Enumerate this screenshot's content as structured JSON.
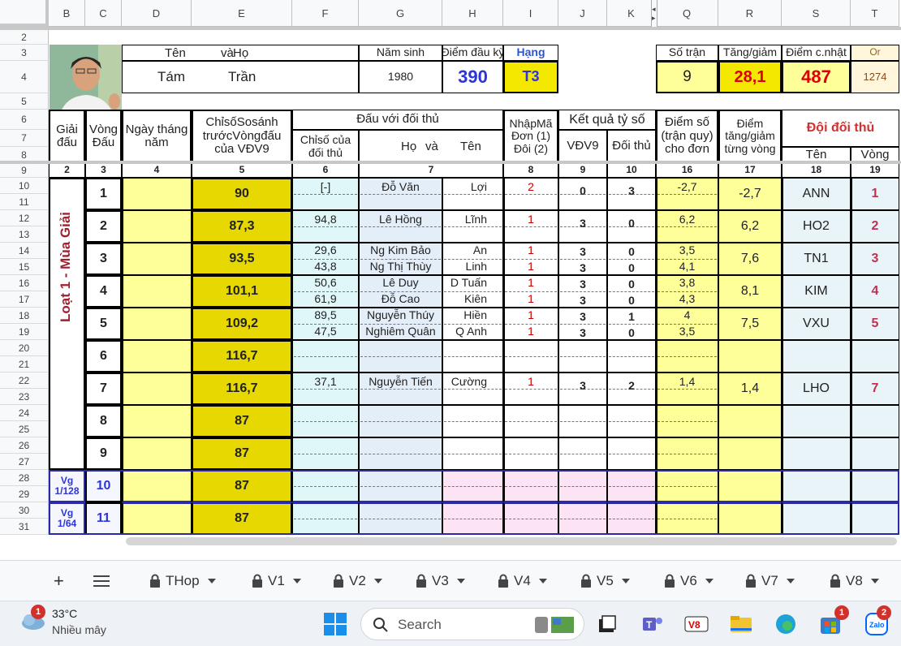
{
  "columns": [
    "B",
    "C",
    "D",
    "E",
    "F",
    "G",
    "H",
    "I",
    "J",
    "K",
    "Q",
    "R",
    "S",
    "T"
  ],
  "rows": [
    "2",
    "3",
    "4",
    "5",
    "6",
    "7",
    "8",
    "9",
    "10",
    "11",
    "12",
    "13",
    "14",
    "15",
    "16",
    "17",
    "18",
    "19",
    "20",
    "21",
    "22",
    "23",
    "24",
    "25",
    "26",
    "27",
    "28",
    "29",
    "30",
    "31"
  ],
  "header": {
    "ten_va_ho_label": [
      "Tên",
      "và",
      "Họ"
    ],
    "nam_sinh_label": "Năm sinh",
    "diem_dau_ky_label": "Điểm đầu kỳ",
    "hang_label": "Hạng",
    "ten": "Tám",
    "ho": "Trần",
    "nam_sinh": "1980",
    "diem_dau_ky": "390",
    "hang": "T3",
    "so_tran_label": "Số trận",
    "tang_giam_label": "Tăng/giảm",
    "diem_cnhat_label": "Điểm c.nhật",
    "or_label": "Or",
    "so_tran": "9",
    "tang_giam": "28,1",
    "diem_cnhat": "487",
    "or_value": "1274"
  },
  "table_head": {
    "giai_dau": "Giải đấu",
    "vong_dau": "Vòng Đấu",
    "ngay": "Ngày tháng năm",
    "chiso": "ChỉsốSosánh trướcVòngđấu của VĐV9",
    "dau_voi": "Đấu với đối thủ",
    "chiso_doithu": "Chỉsố của đối thủ",
    "ho": "Họ",
    "va": "và",
    "ten": "Tên",
    "nhapma": "NhậpMã Đơn (1) Đôi (2)",
    "ketqua": "Kết quả tỷ số",
    "vdv9": "VĐV9",
    "doithu": "Đối thủ",
    "diemso": "Điểm số (trận quy) cho đơn",
    "diem_tg": "Điểm tăng/giảm từng vòng",
    "doi_doithu": "Đội đối thủ",
    "ten2": "Tên",
    "vong": "Vòng",
    "nums": [
      "2",
      "3",
      "4",
      "5",
      "6",
      "7",
      "8",
      "9",
      "10",
      "16",
      "17",
      "18",
      "19"
    ]
  },
  "season_label": "Loạt 1 - Mùa Giải",
  "rounds": [
    {
      "vong": "1",
      "chiso": "90",
      "lines": [
        {
          "cs": "[-]",
          "ho": "Đỗ Văn",
          "ten": "Lợi",
          "ma": "2",
          "v": "0",
          "d": "3",
          "pts": "-2,7"
        }
      ],
      "tg": "-2,7",
      "team": "ANN",
      "tv": "1"
    },
    {
      "vong": "2",
      "chiso": "87,3",
      "lines": [
        {
          "cs": "94,8",
          "ho": "Lê Hồng",
          "ten": "Lĩnh",
          "ma": "1",
          "v": "3",
          "d": "0",
          "pts": "6,2"
        }
      ],
      "tg": "6,2",
      "team": "HO2",
      "tv": "2"
    },
    {
      "vong": "3",
      "chiso": "93,5",
      "lines": [
        {
          "cs": "29,6",
          "ho": "Ng Kim Bảo",
          "ten": "An",
          "ma": "1",
          "v": "3",
          "d": "0",
          "pts": "3,5"
        },
        {
          "cs": "43,8",
          "ho": "Ng Thị Thùy",
          "ten": "Linh",
          "ma": "1",
          "v": "3",
          "d": "0",
          "pts": "4,1"
        }
      ],
      "tg": "7,6",
      "team": "TN1",
      "tv": "3"
    },
    {
      "vong": "4",
      "chiso": "101,1",
      "lines": [
        {
          "cs": "50,6",
          "ho": "Lê Duy",
          "ten": "D Tuấn",
          "ma": "1",
          "v": "3",
          "d": "0",
          "pts": "3,8"
        },
        {
          "cs": "61,9",
          "ho": "Đỗ Cao",
          "ten": "Kiên",
          "ma": "1",
          "v": "3",
          "d": "0",
          "pts": "4,3"
        }
      ],
      "tg": "8,1",
      "team": "KIM",
      "tv": "4"
    },
    {
      "vong": "5",
      "chiso": "109,2",
      "lines": [
        {
          "cs": "89,5",
          "ho": "Nguyễn Thúy",
          "ten": "Hiền",
          "ma": "1",
          "v": "3",
          "d": "1",
          "pts": "4"
        },
        {
          "cs": "47,5",
          "ho": "Nghiêm Quân",
          "ten": "Q Anh",
          "ma": "1",
          "v": "3",
          "d": "0",
          "pts": "3,5"
        }
      ],
      "tg": "7,5",
      "team": "VXU",
      "tv": "5"
    },
    {
      "vong": "6",
      "chiso": "116,7",
      "lines": [],
      "tg": "",
      "team": "",
      "tv": ""
    },
    {
      "vong": "7",
      "chiso": "116,7",
      "lines": [
        {
          "cs": "37,1",
          "ho": "Nguyễn Tiến",
          "ten": "Cường",
          "ma": "1",
          "v": "3",
          "d": "2",
          "pts": "1,4"
        }
      ],
      "tg": "1,4",
      "team": "LHO",
      "tv": "7"
    },
    {
      "vong": "8",
      "chiso": "87",
      "lines": [],
      "tg": "",
      "team": "",
      "tv": ""
    },
    {
      "vong": "9",
      "chiso": "87",
      "lines": [],
      "tg": "",
      "team": "",
      "tv": ""
    },
    {
      "vong": "10",
      "chiso": "87",
      "lines": [],
      "tg": "",
      "team": "",
      "tv": "",
      "giai": "Vg 1/128"
    },
    {
      "vong": "11",
      "chiso": "87",
      "lines": [],
      "tg": "",
      "team": "",
      "tv": "",
      "giai": "Vg 1/64"
    }
  ],
  "tabs": [
    "THop",
    "V1",
    "V2",
    "V3",
    "V4",
    "V5",
    "V6",
    "V7",
    "V8"
  ],
  "taskbar": {
    "temp": "33°C",
    "weather": "Nhiều mây",
    "weather_badge": "1",
    "search": "Search",
    "store_badge": "1",
    "zalo_badge": "2"
  }
}
